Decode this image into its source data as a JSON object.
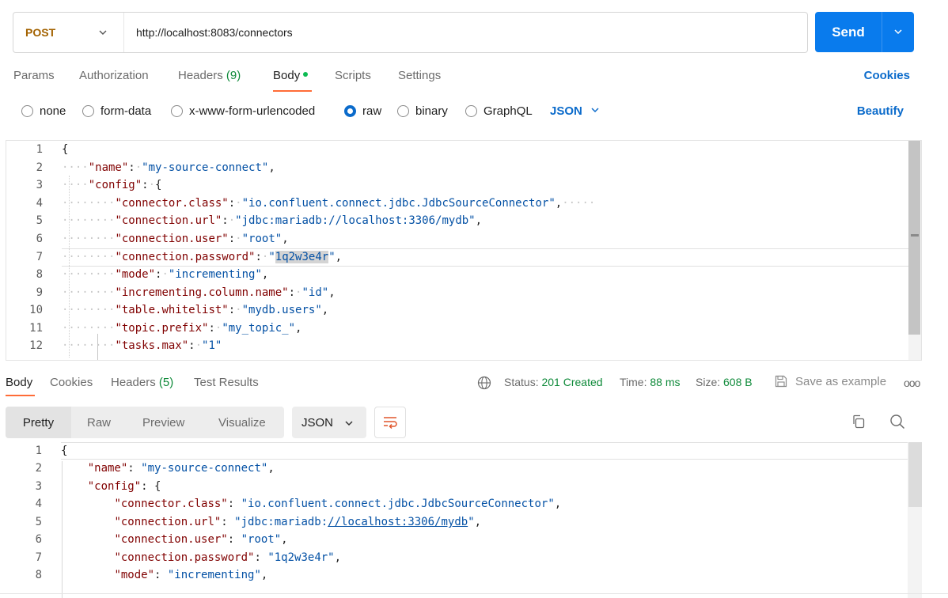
{
  "request": {
    "method": "POST",
    "url": "http://localhost:8083/connectors",
    "send_label": "Send"
  },
  "tabs": [
    {
      "label": "Params"
    },
    {
      "label": "Authorization"
    },
    {
      "label": "Headers",
      "count": "(9)"
    },
    {
      "label": "Body"
    },
    {
      "label": "Scripts"
    },
    {
      "label": "Settings"
    }
  ],
  "cookies_label": "Cookies",
  "body_types": [
    "none",
    "form-data",
    "x-www-form-urlencoded",
    "raw",
    "binary",
    "GraphQL"
  ],
  "body_type_selected": "raw",
  "body_language": "JSON",
  "beautify_label": "Beautify",
  "request_lines": [
    {
      "n": "1"
    },
    {
      "n": "2"
    },
    {
      "n": "3"
    },
    {
      "n": "4"
    },
    {
      "n": "5"
    },
    {
      "n": "6"
    },
    {
      "n": "7"
    },
    {
      "n": "8"
    },
    {
      "n": "9"
    },
    {
      "n": "10"
    },
    {
      "n": "11"
    },
    {
      "n": "12"
    }
  ],
  "json": {
    "name_key": "\"name\"",
    "name_val": "\"my-source-connect\"",
    "config_key": "\"config\"",
    "connector_class_key": "\"connector.class\"",
    "connector_class_val": "\"io.confluent.connect.jdbc.JdbcSourceConnector\"",
    "connection_url_key": "\"connection.url\"",
    "connection_url_val": "\"jdbc:mariadb://localhost:3306/mydb\"",
    "connection_url_prefix": "\"jdbc:mariadb:",
    "connection_url_link": "//localhost:3306/mydb",
    "connection_user_key": "\"connection.user\"",
    "connection_user_val": "\"root\"",
    "connection_password_key": "\"connection.password\"",
    "connection_password_plain": "1q2w3e4r",
    "connection_password_val": "\"1q2w3e4r\"",
    "mode_key": "\"mode\"",
    "mode_val": "\"incrementing\"",
    "incrementing_key": "\"incrementing.column.name\"",
    "incrementing_val": "\"id\"",
    "table_key": "\"table.whitelist\"",
    "table_val": "\"mydb.users\"",
    "topic_key": "\"topic.prefix\"",
    "topic_val": "\"my_topic_\"",
    "tasks_key": "\"tasks.max\"",
    "tasks_val": "\"1\""
  },
  "response": {
    "tabs": [
      {
        "label": "Body"
      },
      {
        "label": "Cookies"
      },
      {
        "label": "Headers",
        "count": "(5)"
      },
      {
        "label": "Test Results"
      }
    ],
    "status_label": "Status:",
    "status_value": "201 Created",
    "time_label": "Time:",
    "time_value": "88 ms",
    "size_label": "Size:",
    "size_value": "608 B",
    "save_example_label": "Save as example",
    "more_label": "ooo",
    "view_modes": [
      "Pretty",
      "Raw",
      "Preview",
      "Visualize"
    ],
    "view_mode_selected": "Pretty",
    "format": "JSON",
    "lines": [
      {
        "n": "1"
      },
      {
        "n": "2"
      },
      {
        "n": "3"
      },
      {
        "n": "4"
      },
      {
        "n": "5"
      },
      {
        "n": "6"
      },
      {
        "n": "7"
      },
      {
        "n": "8"
      }
    ]
  },
  "colors": {
    "accent": "#097bed",
    "method": "#a36200",
    "tab_underline": "#ff6c37",
    "status_ok": "#0f8a3a",
    "link": "#0b6bcb"
  }
}
